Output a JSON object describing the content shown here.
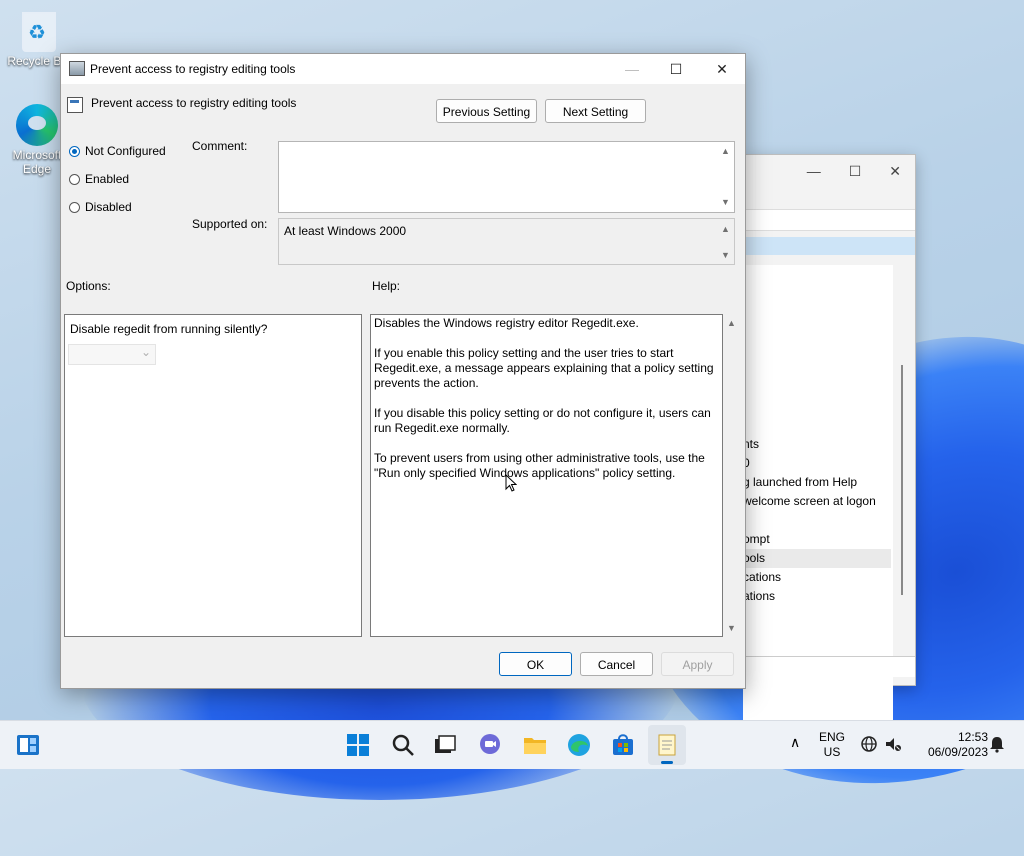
{
  "desktop": {
    "recycle_bin_label": "Recycle Bin",
    "edge_label": "Microsoft Edge"
  },
  "background_window": {
    "items": [
      "nts",
      "0",
      "g launched from Help",
      "welcome screen at logon",
      "ompt",
      "ools",
      "cations",
      "ations"
    ]
  },
  "dialog": {
    "window_title": "Prevent access to registry editing tools",
    "policy_name": "Prevent access to registry editing tools",
    "previous_setting": "Previous Setting",
    "next_setting": "Next Setting",
    "state_options": [
      {
        "label": "Not Configured",
        "selected": true
      },
      {
        "label": "Enabled",
        "selected": false
      },
      {
        "label": "Disabled",
        "selected": false
      }
    ],
    "comment_label": "Comment:",
    "comment_value": "",
    "supported_on_label": "Supported on:",
    "supported_on_value": "At least Windows 2000",
    "options_label": "Options:",
    "help_label": "Help:",
    "option_question": "Disable regedit from running silently?",
    "option_select_value": "",
    "help_paragraphs": [
      "Disables the Windows registry editor Regedit.exe.",
      "If you enable this policy setting and the user tries to start Regedit.exe, a message appears explaining that a policy setting prevents the action.",
      "If you disable this policy setting or do not configure it, users can run Regedit.exe normally.",
      "To prevent users from using other administrative tools, use the \"Run only specified Windows applications\" policy setting."
    ],
    "ok_label": "OK",
    "cancel_label": "Cancel",
    "apply_label": "Apply",
    "minimize_glyph": "—",
    "maximize_glyph": "☐",
    "close_glyph": "✕"
  },
  "taskbar": {
    "language_top": "ENG",
    "language_bottom": "US",
    "time": "12:53",
    "date": "06/09/2023",
    "icons": [
      "widgets-icon",
      "start-icon",
      "search-icon",
      "task-view-icon",
      "chat-icon",
      "file-explorer-icon",
      "edge-icon",
      "store-icon",
      "notepad-icon"
    ],
    "accent": "#0067c0"
  }
}
